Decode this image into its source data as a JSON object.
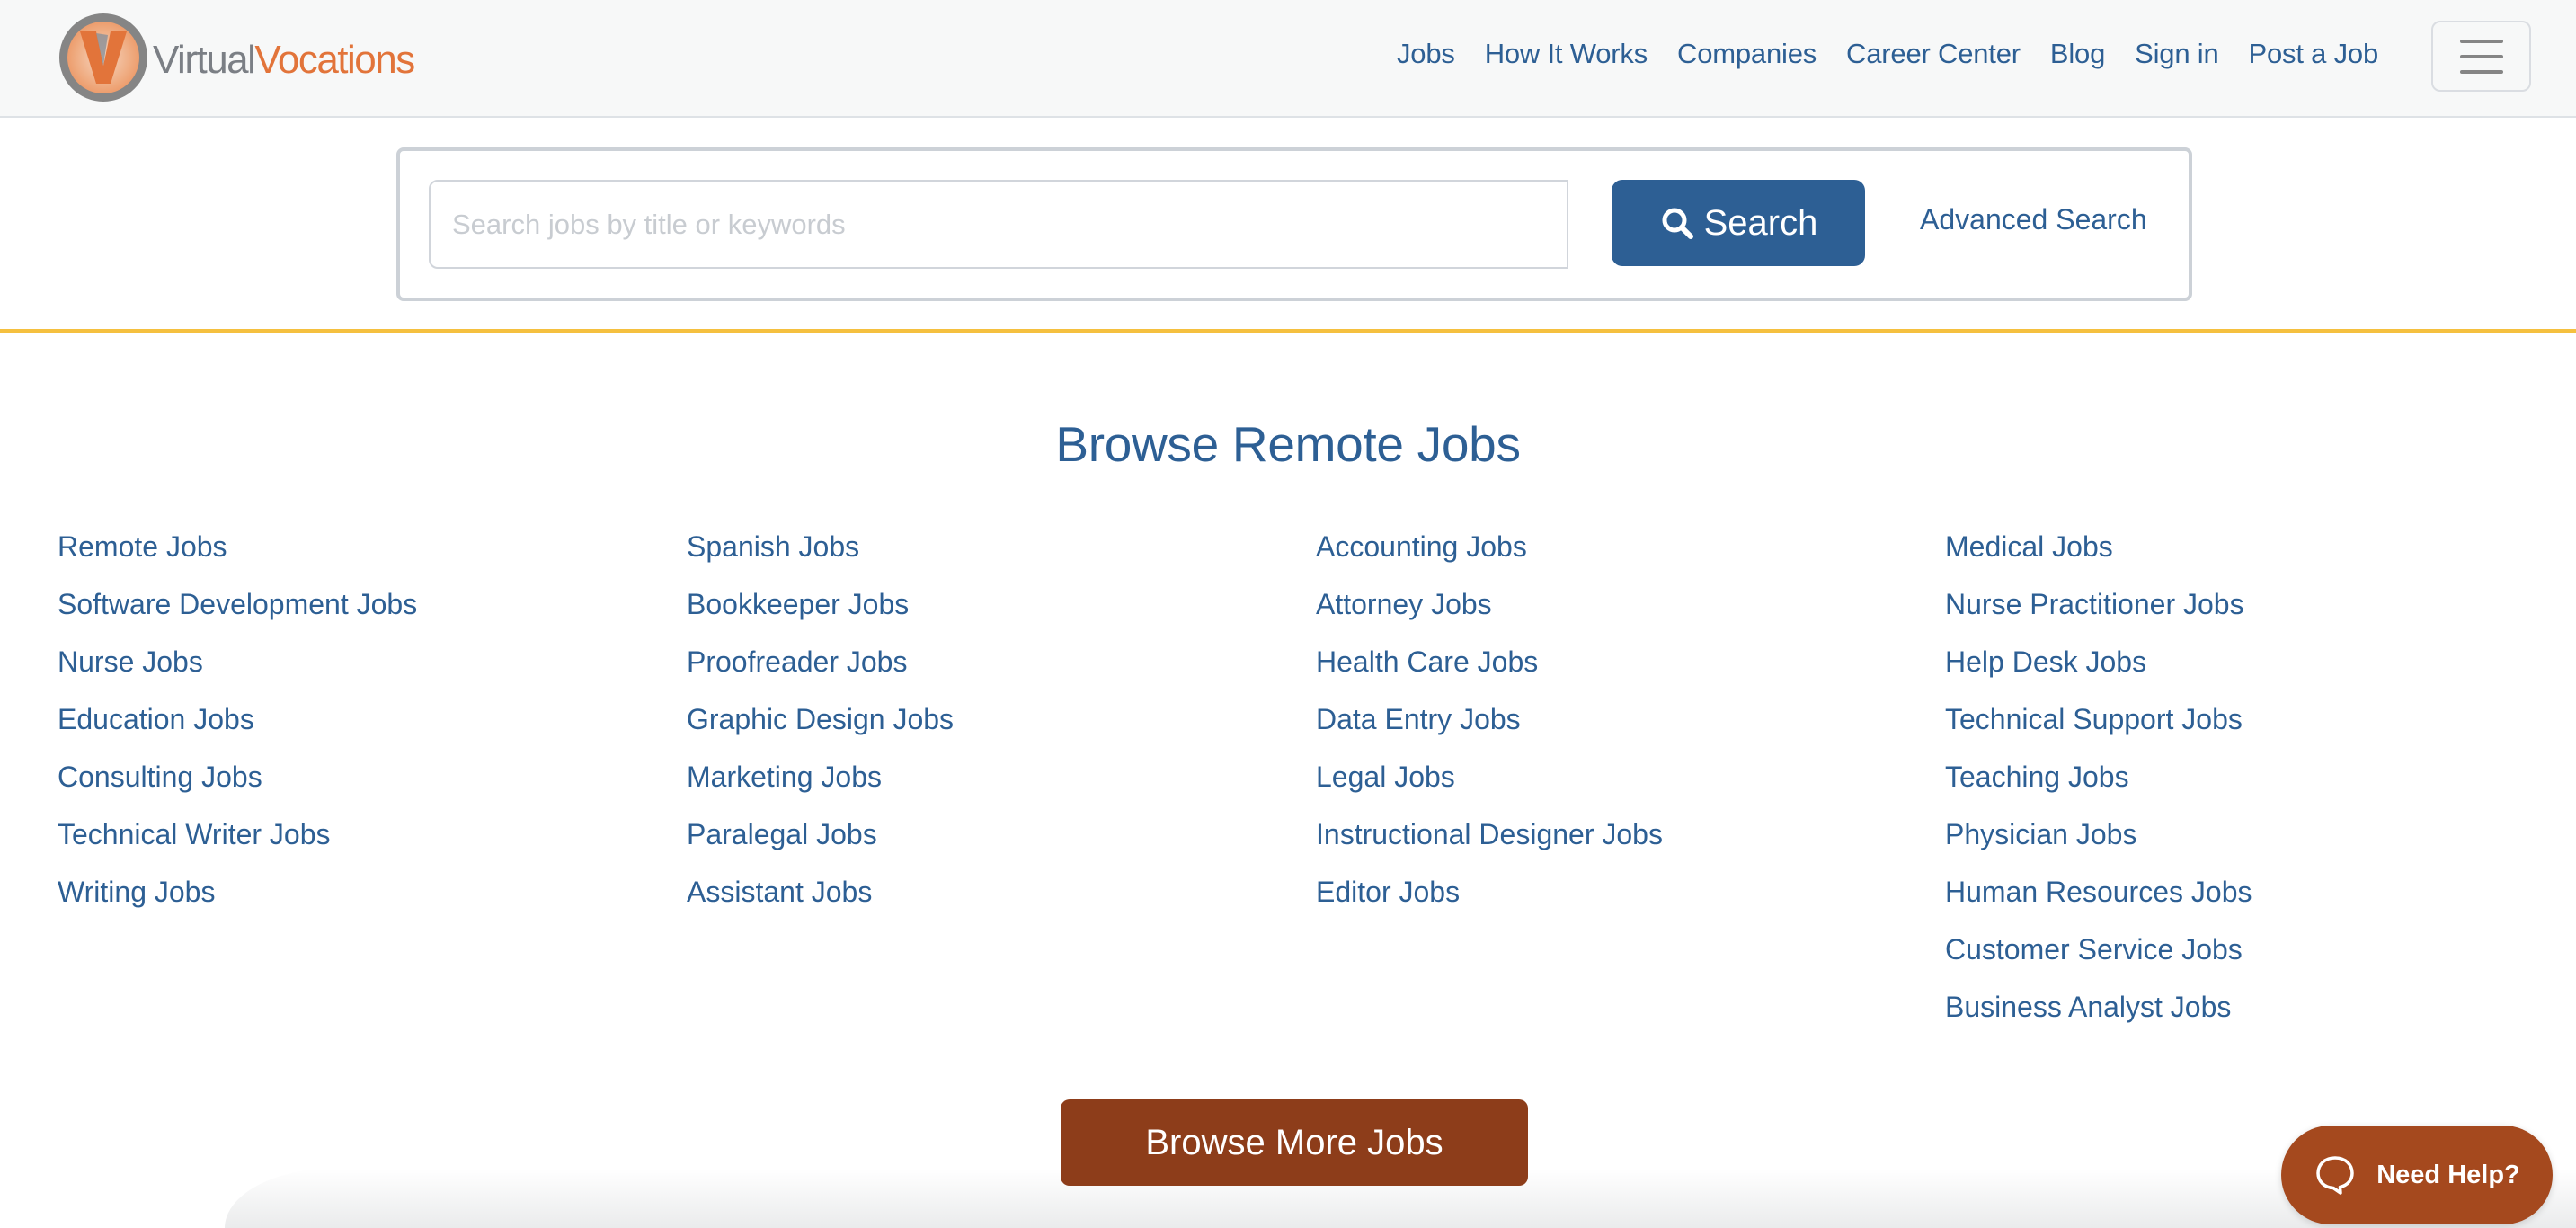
{
  "brand": {
    "name_part1": "Virtual",
    "name_part2": "Vocations",
    "logo_letter": "V",
    "colors": {
      "gray": "#7b7f85",
      "orange": "#e2743a"
    }
  },
  "nav": {
    "items": [
      {
        "label": "Jobs"
      },
      {
        "label": "How It Works"
      },
      {
        "label": "Companies"
      },
      {
        "label": "Career Center"
      },
      {
        "label": "Blog"
      },
      {
        "label": "Sign in"
      },
      {
        "label": "Post a Job"
      }
    ],
    "menu_icon": "hamburger-menu-icon"
  },
  "search": {
    "placeholder": "Search jobs by title or keywords",
    "value": "",
    "button_label": "Search",
    "button_icon": "search-icon",
    "advanced_label": "Advanced Search"
  },
  "browse": {
    "title": "Browse Remote Jobs",
    "columns": [
      [
        "Remote Jobs",
        "Software Development Jobs",
        "Nurse Jobs",
        "Education Jobs",
        "Consulting Jobs",
        "Technical Writer Jobs",
        "Writing Jobs"
      ],
      [
        "Spanish Jobs",
        "Bookkeeper Jobs",
        "Proofreader Jobs",
        "Graphic Design Jobs",
        "Marketing Jobs",
        "Paralegal Jobs",
        "Assistant Jobs"
      ],
      [
        "Accounting Jobs",
        "Attorney Jobs",
        "Health Care Jobs",
        "Data Entry Jobs",
        "Legal Jobs",
        "Instructional Designer Jobs",
        "Editor Jobs"
      ],
      [
        "Medical Jobs",
        "Nurse Practitioner Jobs",
        "Help Desk Jobs",
        "Technical Support Jobs",
        "Teaching Jobs",
        "Physician Jobs",
        "Human Resources Jobs",
        "Customer Service Jobs",
        "Business Analyst Jobs"
      ]
    ],
    "more_button_label": "Browse More Jobs"
  },
  "help_widget": {
    "label": "Need Help?",
    "icon": "chat-bubble-icon"
  },
  "theme": {
    "link_color": "#2d5f94",
    "accent_rule": "#f5c03f",
    "browse_more_bg": "#8d3d1a",
    "help_bg": "#a5491e"
  }
}
